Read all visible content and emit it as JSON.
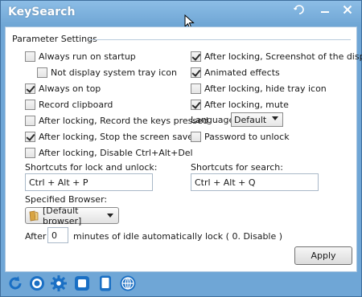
{
  "window": {
    "title": "KeySearch",
    "controls": [
      "skin-icon",
      "minimize-icon",
      "close-icon"
    ]
  },
  "group": {
    "title": "Parameter Settings"
  },
  "options_left": [
    {
      "label": "Always run on startup",
      "checked": false
    },
    {
      "label": "Not display system tray icon",
      "checked": false
    },
    {
      "label": "Always on top",
      "checked": true
    },
    {
      "label": "Record clipboard",
      "checked": false
    },
    {
      "label": "After locking, Record the keys pressed",
      "checked": false
    },
    {
      "label": "After locking, Stop the screen saver",
      "checked": true
    },
    {
      "label": "After locking, Disable Ctrl+Alt+Del",
      "checked": false
    }
  ],
  "options_right": [
    {
      "label": "After locking, Screenshot of the display",
      "checked": true
    },
    {
      "label": "Animated effects",
      "checked": true
    },
    {
      "label": "After locking, hide tray icon",
      "checked": false
    },
    {
      "label": "After locking, mute",
      "checked": true
    },
    {
      "label": "Password to unlock",
      "checked": false
    }
  ],
  "language": {
    "label": "Language",
    "value": "Default"
  },
  "shortcuts": {
    "lock_label": "Shortcuts for lock and unlock:",
    "lock_value": "Ctrl + Alt + P",
    "search_label": "Shortcuts for search:",
    "search_value": "Ctrl + Alt + Q"
  },
  "browser": {
    "label": "Specified Browser:",
    "value": "[Default browser]"
  },
  "idle": {
    "prefix": "After",
    "value": "0",
    "suffix": "minutes of idle automatically lock ( 0. Disable )"
  },
  "apply_label": "Apply",
  "bottom_icons": [
    "refresh-icon",
    "target-icon",
    "settings-gear-icon",
    "square-icon",
    "tablet-icon",
    "globe-icon"
  ],
  "colors": {
    "titlebar": "#6fa6d6",
    "accent": "#1a6fc4"
  }
}
